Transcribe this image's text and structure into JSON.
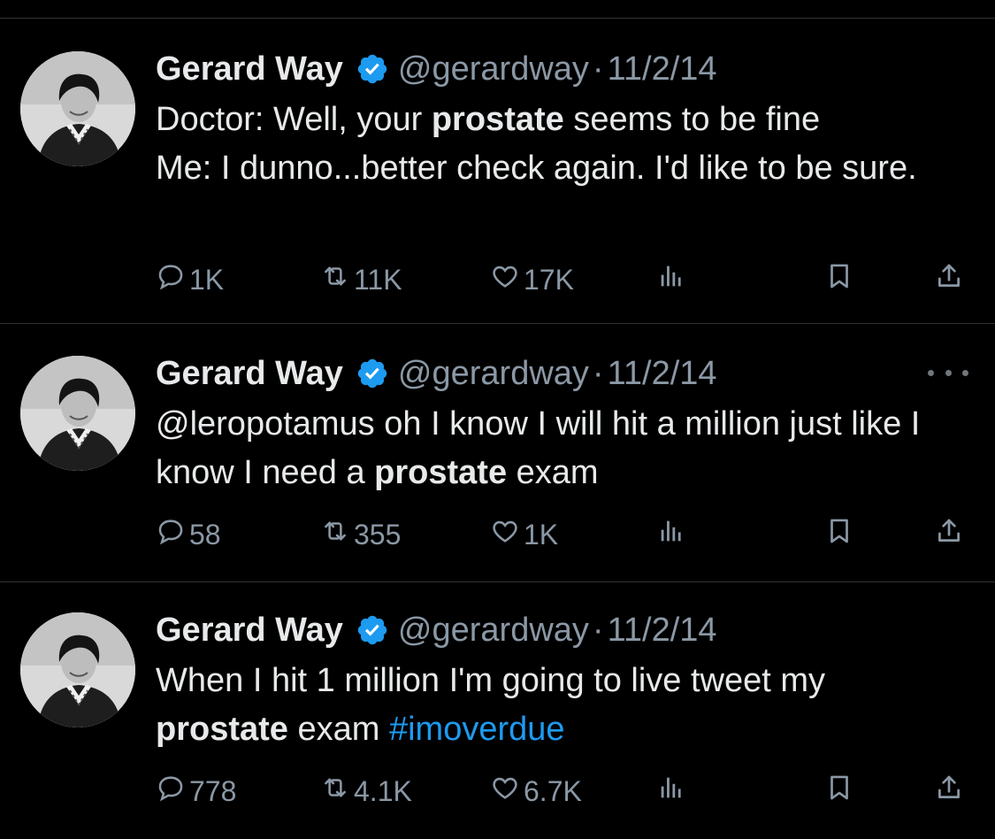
{
  "tweets": [
    {
      "name": "Gerard Way",
      "handle": "@gerardway",
      "separator": "·",
      "date": "11/2/14",
      "text_parts": [
        {
          "t": "Doctor: Well, your ",
          "style": "normal"
        },
        {
          "t": "prostate",
          "style": "bold"
        },
        {
          "t": " seems to be fine",
          "style": "normal"
        },
        {
          "t": "\n",
          "style": "break"
        },
        {
          "t": "Me: I dunno...better check again. I'd like to be sure.",
          "style": "normal"
        }
      ],
      "replies": "1K",
      "reposts": "11K",
      "likes": "17K",
      "show_more": false
    },
    {
      "name": "Gerard Way",
      "handle": "@gerardway",
      "separator": "·",
      "date": "11/2/14",
      "text_parts": [
        {
          "t": "@leropotamus oh I know I will hit a million just like I know I need a ",
          "style": "normal"
        },
        {
          "t": "prostate",
          "style": "bold"
        },
        {
          "t": " exam",
          "style": "normal"
        }
      ],
      "replies": "58",
      "reposts": "355",
      "likes": "1K",
      "show_more": true
    },
    {
      "name": "Gerard Way",
      "handle": "@gerardway",
      "separator": "·",
      "date": "11/2/14",
      "text_parts": [
        {
          "t": "When I hit 1 million I'm going to live tweet my ",
          "style": "normal"
        },
        {
          "t": "prostate",
          "style": "bold"
        },
        {
          "t": " exam ",
          "style": "normal"
        },
        {
          "t": "#imoverdue",
          "style": "hashtag"
        }
      ],
      "replies": "778",
      "reposts": "4.1K",
      "likes": "6.7K",
      "show_more": false
    }
  ],
  "icons": {
    "reply": "reply-icon",
    "repost": "repost-icon",
    "like": "heart-icon",
    "views": "views-icon",
    "bookmark": "bookmark-icon",
    "share": "share-icon",
    "verified": "verified-badge-icon",
    "more": "more-icon"
  },
  "colors": {
    "background": "#000000",
    "text": "#e7e9ea",
    "muted": "#8b98a5",
    "accent": "#1d9bf0",
    "divider": "#2f3336"
  }
}
